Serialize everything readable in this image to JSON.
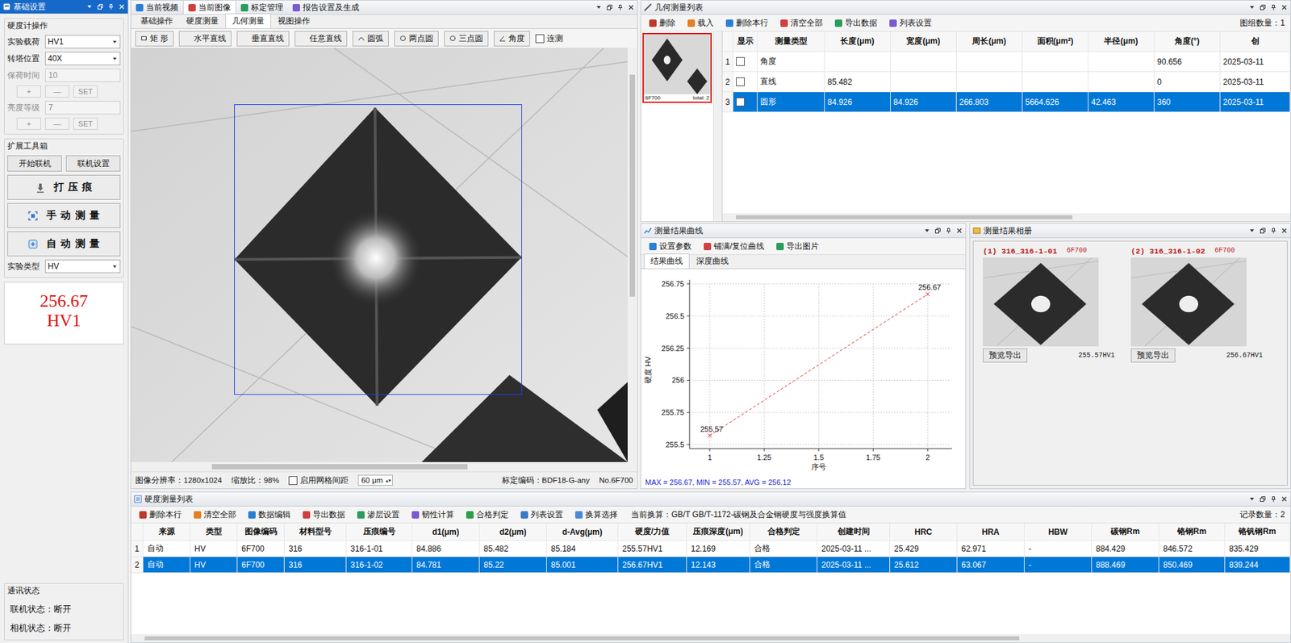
{
  "left_panel": {
    "title": "基础设置",
    "active": true,
    "hardness_section": "硬度计操作",
    "fields": [
      {
        "label": "实验载荷",
        "value": "HV1",
        "kind": "select",
        "disabled": false,
        "buttons": []
      },
      {
        "label": "转塔位置",
        "value": "40X",
        "kind": "select",
        "disabled": false,
        "buttons": []
      },
      {
        "label": "保荷时间",
        "value": "10",
        "kind": "input",
        "disabled": true,
        "buttons": [
          "+",
          "—",
          "SET"
        ]
      },
      {
        "label": "亮度等级",
        "value": "7",
        "kind": "input",
        "disabled": true,
        "buttons": [
          "+",
          "—",
          "SET"
        ]
      }
    ],
    "toolbox_section": "扩展工具箱",
    "small_buttons": [
      "开始联机",
      "联机设置"
    ],
    "big_buttons": [
      "打 压 痕",
      "手 动 测 量",
      "自 动 测 量"
    ],
    "experiment_type": {
      "label": "实验类型",
      "value": "HV"
    },
    "result": {
      "value": "256.67",
      "unit": "HV1"
    },
    "comm_section": "通讯状态",
    "statuses": [
      "联机状态：断开",
      "相机状态：断开"
    ]
  },
  "image_panel": {
    "tabs": [
      {
        "label": "当前视频",
        "selected": false
      },
      {
        "label": "当前图像",
        "selected": true
      },
      {
        "label": "标定管理",
        "selected": false
      },
      {
        "label": "报告设置及生成",
        "selected": false
      }
    ],
    "subtabs": [
      {
        "label": "基础操作",
        "selected": false
      },
      {
        "label": "硬度测量",
        "selected": false
      },
      {
        "label": "几何测量",
        "selected": true
      },
      {
        "label": "视图操作",
        "selected": false
      }
    ],
    "tools": [
      "矩 形",
      "水平直线",
      "垂直直线",
      "任意直线",
      "圆弧",
      "两点圆",
      "三点圆",
      "角度"
    ],
    "continuous": {
      "label": "连测",
      "checked": false
    },
    "status": {
      "resolution": "图像分辨率：1280x1024",
      "zoom": "缩放比：98%",
      "grid": {
        "label": "启用网格间距",
        "checked": false
      },
      "grid_value": "60 μm",
      "calibration": "标定编码：BDF18-G-any",
      "number": "No.6F700"
    }
  },
  "geometry_list": {
    "title": "几何测量列表",
    "toolbar": [
      "删除",
      "载入",
      "删除本行",
      "清空全部",
      "导出数据",
      "列表设置"
    ],
    "group_count": "图组数量：1",
    "thumbnail": {
      "code": "6F700",
      "total": "total: 2",
      "selected": true
    },
    "columns": [
      "显示",
      "测量类型",
      "长度(μm)",
      "宽度(μm)",
      "周长(μm)",
      "面积(μm²)",
      "半径(μm)",
      "角度(°)",
      "创"
    ],
    "rows": [
      {
        "index": "1",
        "shown": false,
        "selected": false,
        "cells": [
          "角度",
          "",
          "",
          "",
          "",
          "",
          "90.656",
          "2025-03-11"
        ]
      },
      {
        "index": "2",
        "shown": false,
        "selected": false,
        "cells": [
          "直线",
          "85.482",
          "",
          "",
          "",
          "",
          "0",
          "2025-03-11"
        ]
      },
      {
        "index": "3",
        "shown": false,
        "selected": true,
        "cells": [
          "圆形",
          "84.926",
          "84.926",
          "266.803",
          "5664.626",
          "42.463",
          "360",
          "2025-03-11"
        ]
      }
    ]
  },
  "curve_panel": {
    "title": "测量结果曲线",
    "toolbar": [
      "设置参数",
      "铺满/复位曲线",
      "导出图片"
    ],
    "tabs": [
      {
        "label": "结果曲线",
        "selected": true
      },
      {
        "label": "深度曲线",
        "selected": false
      }
    ],
    "chart": {
      "y_label": "硬度 HV",
      "x_label": "序号",
      "y_ticks": [
        "256.75",
        "256.5",
        "256.25",
        "256",
        "255.75",
        "255.5"
      ],
      "x_ticks": [
        "1",
        "1.25",
        "1.5",
        "1.75",
        "2"
      ],
      "series": [
        {
          "values": [
            255.57,
            256.67
          ],
          "labels": [
            "255.57",
            "256.67"
          ],
          "color": "#e03030"
        }
      ]
    },
    "summary": "MAX = 256.67, MIN = 255.57, AVG = 256.12"
  },
  "album_panel": {
    "title": "测量结果相册",
    "items": [
      {
        "title": "(1) 316_316-1-01",
        "code": "6F700",
        "button": "预览导出",
        "value": "255.57HV1"
      },
      {
        "title": "(2) 316_316-1-02",
        "code": "6F700",
        "button": "预览导出",
        "value": "256.67HV1"
      }
    ]
  },
  "hardness_list": {
    "title": "硬度测量列表",
    "toolbar": [
      "删除本行",
      "清空全部",
      "数据编辑",
      "导出数据",
      "渗层设置",
      "韧性计算",
      "合格判定",
      "列表设置",
      "换算选择"
    ],
    "conversion": "当前换算：GB/T GB/T-1172-碳钢及合金钢硬度与强度换算值",
    "record_count": "记录数量：2",
    "columns": [
      "来源",
      "类型",
      "图像编码",
      "材料型号",
      "压痕编号",
      "d1(μm)",
      "d2(μm)",
      "d-Avg(μm)",
      "硬度/力值",
      "压痕深度(μm)",
      "合格判定",
      "创建时间",
      "HRC",
      "HRA",
      "HBW",
      "碳钢Rm",
      "铬钢Rm",
      "铬钒钢Rm"
    ],
    "rows": [
      {
        "index": "1",
        "selected": false,
        "cells": [
          "自动",
          "HV",
          "6F700",
          "316",
          "316-1-01",
          "84.886",
          "85.482",
          "85.184",
          "255.57HV1",
          "12.169",
          "合格",
          "2025-03-11 ...",
          "25.429",
          "62.971",
          "-",
          "884.429",
          "846.572",
          "835.429"
        ]
      },
      {
        "index": "2",
        "selected": true,
        "cells": [
          "自动",
          "HV",
          "6F700",
          "316",
          "316-1-02",
          "84.781",
          "85.22",
          "85.001",
          "256.67HV1",
          "12.143",
          "合格",
          "2025-03-11 ...",
          "25.612",
          "63.067",
          "-",
          "888.469",
          "850.469",
          "839.244"
        ]
      }
    ]
  }
}
